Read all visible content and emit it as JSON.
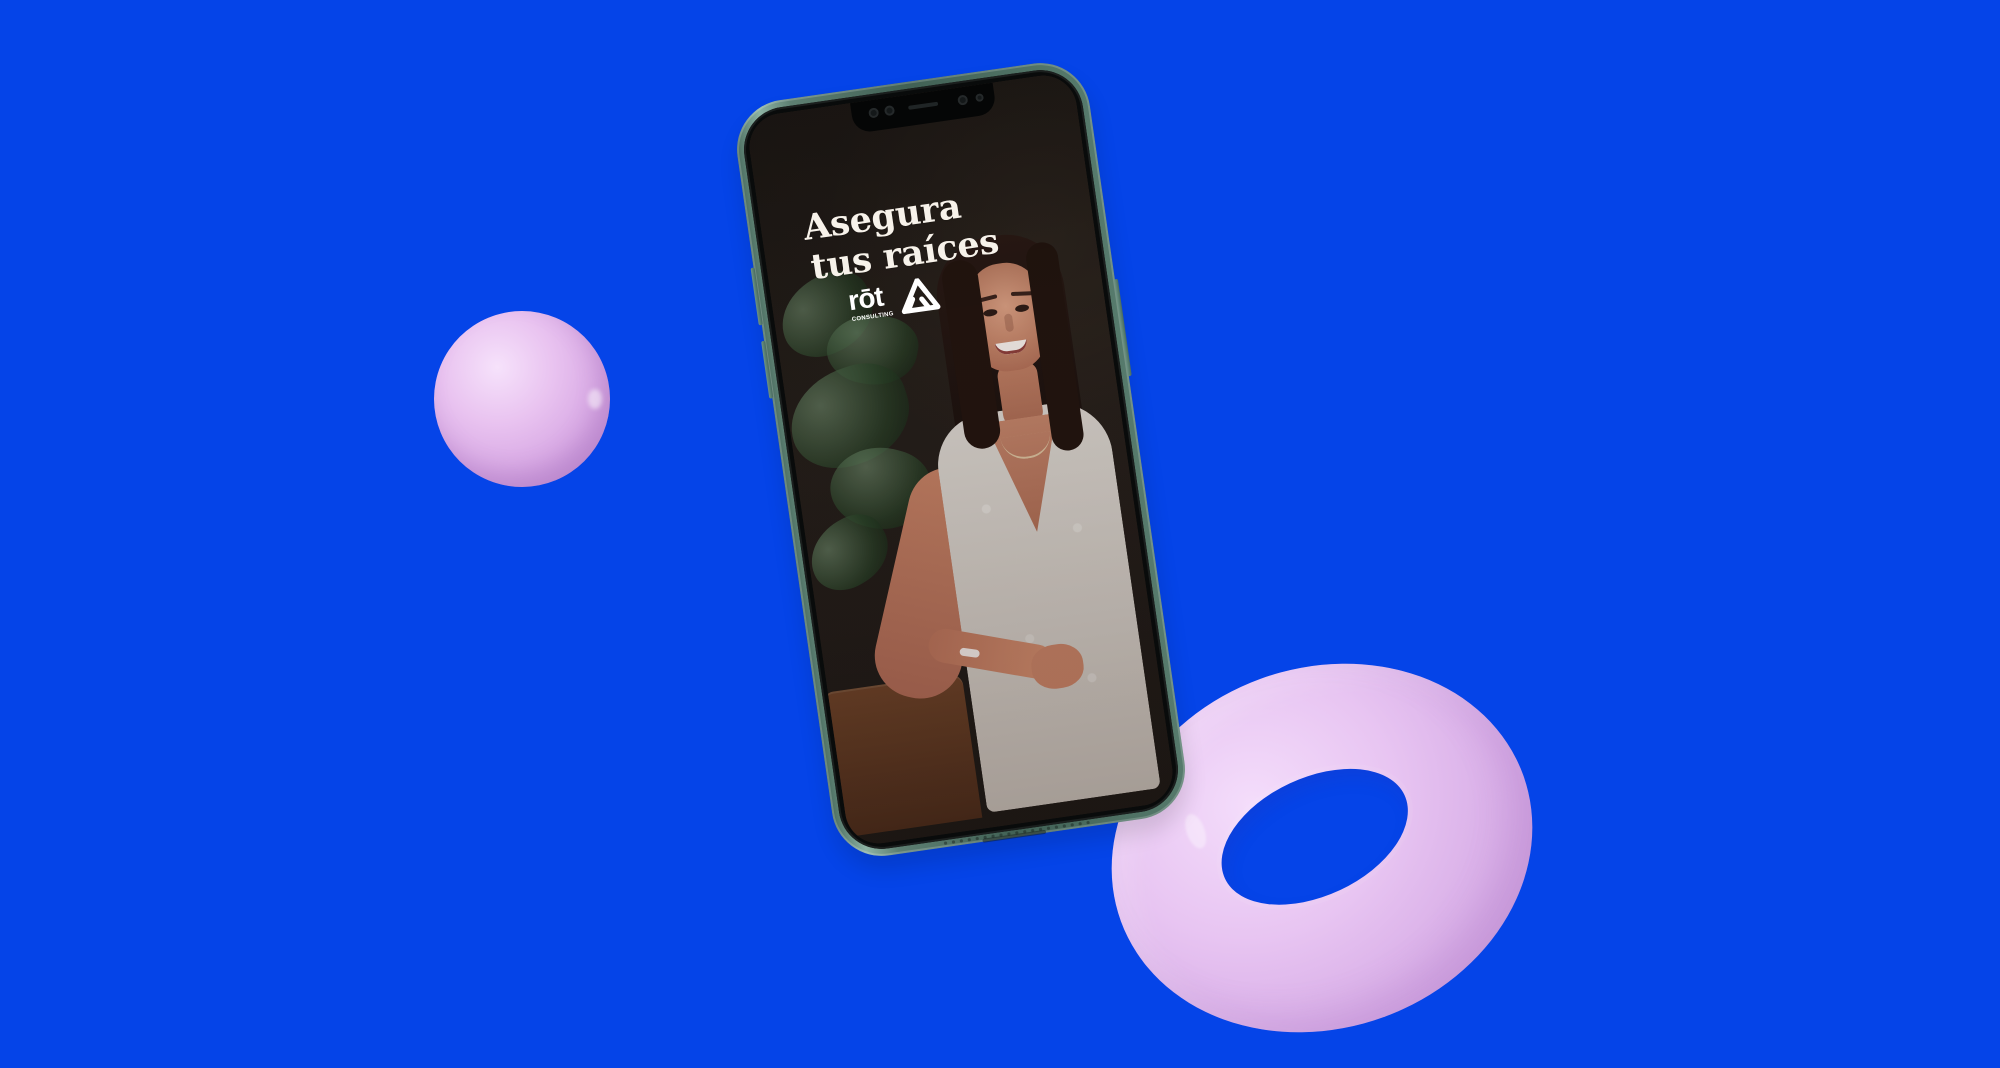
{
  "screen_text": {
    "headline_line_1": "Asegura",
    "headline_line_2": "tus raíces",
    "brand_name": "rōt",
    "brand_subtitle": "CONSULTING"
  },
  "colors": {
    "background": "#0544e8",
    "shape_pink": "#e8c3f0",
    "phone_green": "#5d7f72",
    "screen_text": "#f7f2ea"
  },
  "icons": {
    "brand_mark": "triangle-logo-icon"
  }
}
